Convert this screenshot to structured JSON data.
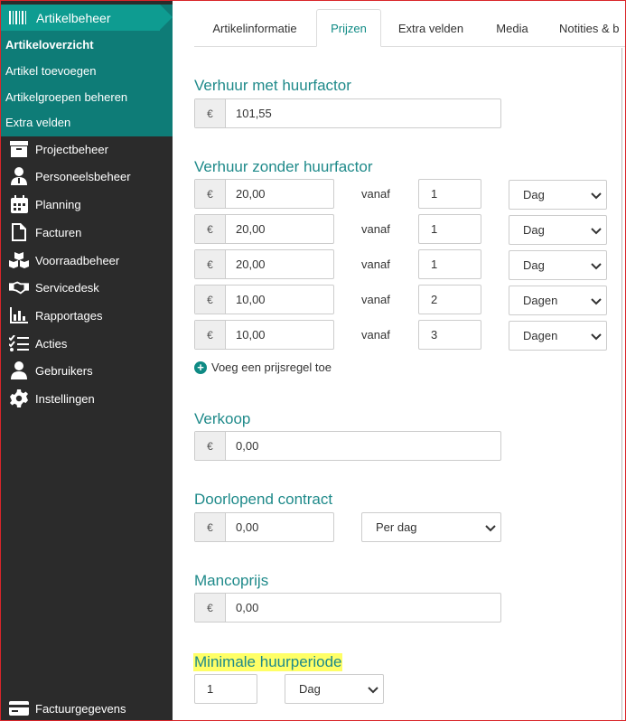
{
  "sidebar": {
    "header": "Artikelbeheer",
    "sub_items": [
      "Artikeloverzicht",
      "Artikel toevoegen",
      "Artikelgroepen beheren",
      "Extra velden"
    ],
    "nav": [
      "Projectbeheer",
      "Personeelsbeheer",
      "Planning",
      "Facturen",
      "Voorraadbeheer",
      "Servicedesk",
      "Rapportages",
      "Acties",
      "Gebruikers",
      "Instellingen"
    ],
    "footer": "Factuurgegevens"
  },
  "tabs": [
    "Artikelinformatie",
    "Prijzen",
    "Extra velden",
    "Media",
    "Notities & b"
  ],
  "form": {
    "currency": "€",
    "verhuur_met": {
      "title": "Verhuur met huurfactor",
      "value": "101,55"
    },
    "verhuur_zonder": {
      "title": "Verhuur zonder huurfactor",
      "vanaf_label": "vanaf",
      "rows": [
        {
          "price": "20,00",
          "qty": "1",
          "unit": "Dag"
        },
        {
          "price": "20,00",
          "qty": "1",
          "unit": "Dag"
        },
        {
          "price": "20,00",
          "qty": "1",
          "unit": "Dag"
        },
        {
          "price": "10,00",
          "qty": "2",
          "unit": "Dagen"
        },
        {
          "price": "10,00",
          "qty": "3",
          "unit": "Dagen"
        }
      ],
      "add_rule": "Voeg een prijsregel toe"
    },
    "verkoop": {
      "title": "Verkoop",
      "value": "0,00"
    },
    "doorlopend": {
      "title": "Doorlopend contract",
      "value": "0,00",
      "period": "Per dag"
    },
    "manco": {
      "title": "Mancoprijs",
      "value": "0,00"
    },
    "min_huur": {
      "title": "Minimale huurperiode",
      "value": "1",
      "unit": "Dag"
    }
  },
  "colors": {
    "sidebar_bg": "#2b2b2b",
    "teal": "#0e7c77",
    "heading": "#1f8a8a",
    "highlight": "#ffff66"
  }
}
